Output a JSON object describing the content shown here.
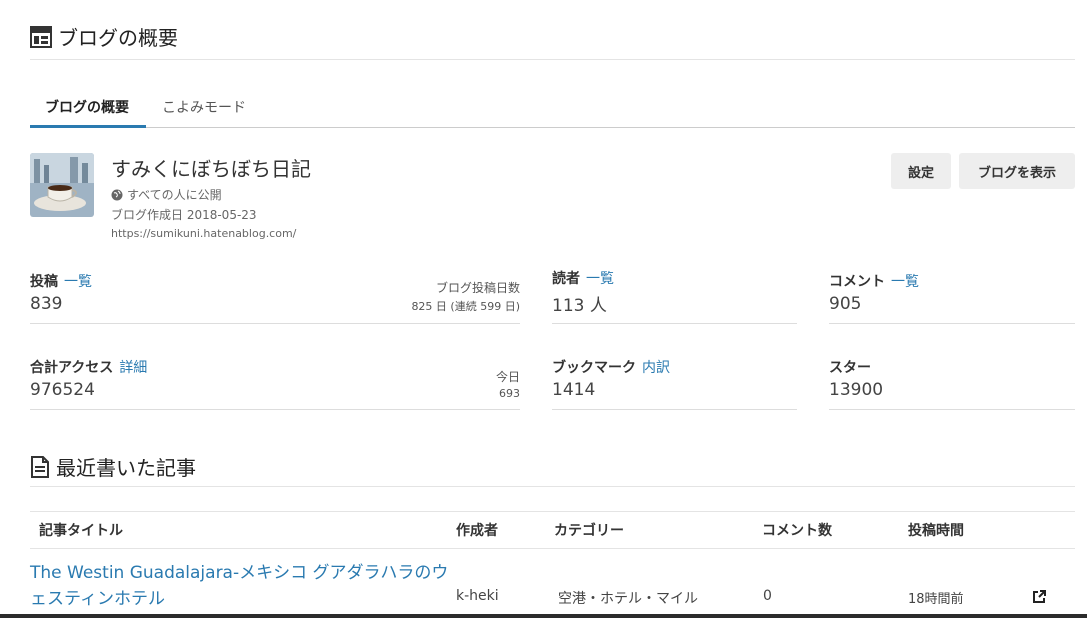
{
  "header": {
    "title": "ブログの概要",
    "icon": "dashboard-icon"
  },
  "tabs": [
    {
      "label": "ブログの概要",
      "active": true
    },
    {
      "label": "こよみモード",
      "active": false
    }
  ],
  "blog": {
    "name": "すみくにぼちぼち日記",
    "visibility": "すべての人に公開",
    "created": "ブログ作成日 2018-05-23",
    "url": "https://sumikuni.hatenablog.com/"
  },
  "buttons": {
    "settings": "設定",
    "view_blog": "ブログを表示"
  },
  "stats": {
    "posts": {
      "label": "投稿",
      "link": "一覧",
      "value": "839",
      "side_label": "ブログ投稿日数",
      "side_value": "825 日 (連続 599 日)"
    },
    "readers": {
      "label": "読者",
      "link": "一覧",
      "value": "113 人"
    },
    "comments": {
      "label": "コメント",
      "link": "一覧",
      "value": "905"
    },
    "access": {
      "label": "合計アクセス",
      "link": "詳細",
      "value": "976524",
      "side_label": "今日",
      "side_value": "693"
    },
    "bookmarks": {
      "label": "ブックマーク",
      "link": "内訳",
      "value": "1414"
    },
    "stars": {
      "label": "スター",
      "value": "13900"
    }
  },
  "recent": {
    "title": "最近書いた記事",
    "icon": "document-icon",
    "columns": [
      "記事タイトル",
      "作成者",
      "カテゴリー",
      "コメント数",
      "投稿時間"
    ],
    "rows": [
      {
        "title": "The Westin Guadalajara-メキシコ グアダラハラのウェスティンホテル",
        "author": "k-heki",
        "category": "空港・ホテル・マイル",
        "comments": "0",
        "time": "18時間前",
        "action_icon": "external-link-icon"
      }
    ]
  },
  "colors": {
    "link": "#2a7ab0",
    "tab_active": "#2a7ab0",
    "button_bg": "#eeeeee"
  }
}
